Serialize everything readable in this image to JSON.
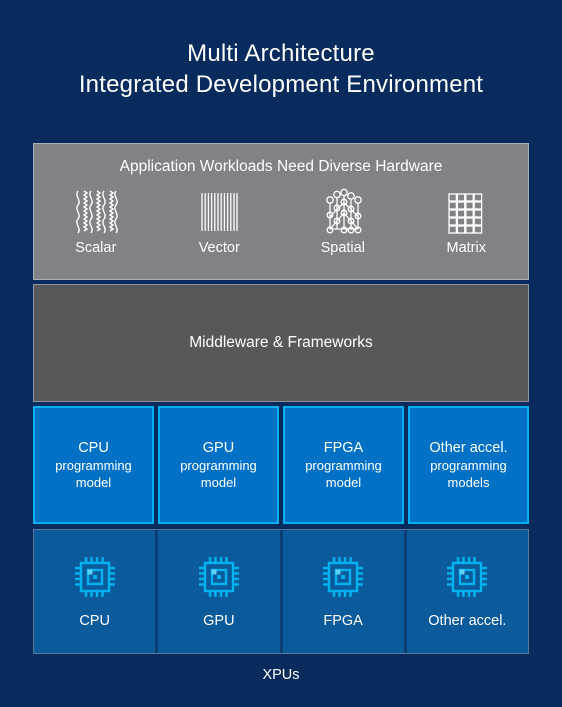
{
  "theme": {
    "background": "#062b5c",
    "panel_gray_light": "#808285",
    "panel_gray_dark": "#58585b",
    "accent_blue": "#0071c5",
    "accent_cyan": "#00b3f0",
    "hardware_blue": "#0b5a9c",
    "text": "#ffffff"
  },
  "header": {
    "line1": "Multi Architecture",
    "line2": "Integrated Development Environment"
  },
  "workloads": {
    "title": "Application Workloads Need Diverse Hardware",
    "items": [
      {
        "label": "Scalar",
        "icon": "scalar-waves-icon"
      },
      {
        "label": "Vector",
        "icon": "vector-bars-icon"
      },
      {
        "label": "Spatial",
        "icon": "spatial-network-icon"
      },
      {
        "label": "Matrix",
        "icon": "matrix-grid-icon"
      }
    ]
  },
  "middleware": {
    "title": "Middleware & Frameworks"
  },
  "programming_models": [
    {
      "name": "CPU",
      "sub1": "programming",
      "sub2": "model"
    },
    {
      "name": "GPU",
      "sub1": "programming",
      "sub2": "model"
    },
    {
      "name": "FPGA",
      "sub1": "programming",
      "sub2": "model"
    },
    {
      "name": "Other accel.",
      "sub1": "programming",
      "sub2": "models"
    }
  ],
  "hardware": [
    {
      "label": "CPU",
      "icon": "chip-icon"
    },
    {
      "label": "GPU",
      "icon": "chip-icon"
    },
    {
      "label": "FPGA",
      "icon": "chip-icon"
    },
    {
      "label": "Other accel.",
      "icon": "chip-icon"
    }
  ],
  "caption": "XPUs"
}
